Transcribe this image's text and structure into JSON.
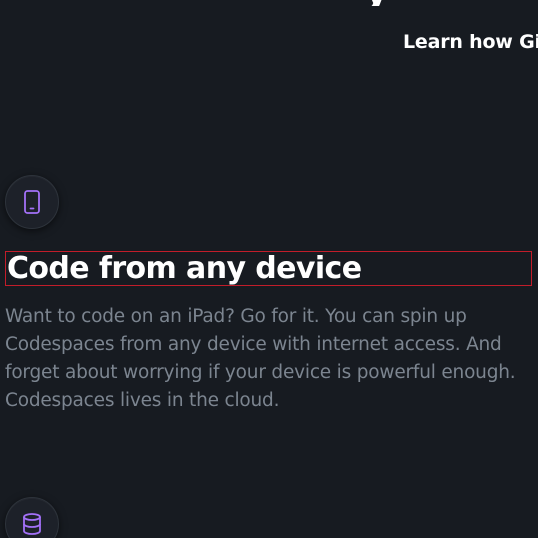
{
  "header": {
    "heading_fragment": "y",
    "link_label": "Learn how Git"
  },
  "feature": {
    "icon": "tablet-device-icon",
    "title": "Code from any device",
    "description": "Want to code on an iPad? Go for it. You can spin up Codespaces from any device with internet access. And forget about worrying if your device is powerful enough. Codespaces lives in the cloud."
  },
  "next_feature": {
    "icon": "database-icon"
  },
  "colors": {
    "background": "#171b21",
    "heading": "#ffffff",
    "body_text": "#7c8590",
    "icon_accent": "#a371f7",
    "highlight_border": "#c21d2a"
  }
}
